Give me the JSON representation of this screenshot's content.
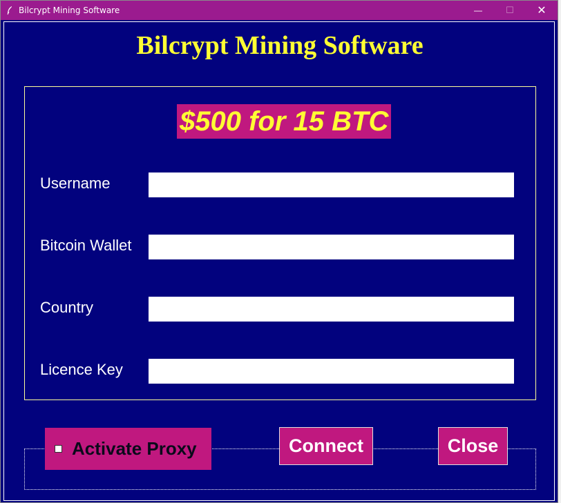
{
  "window": {
    "title": "Bilcrypt Mining Software",
    "controls": {
      "minimize": "—",
      "maximize": "☐",
      "close": "✕"
    }
  },
  "header": {
    "title": "Bilcrypt Mining Software"
  },
  "offer": {
    "text": "$500 for 15 BTC"
  },
  "form": {
    "fields": [
      {
        "label": "Username",
        "value": ""
      },
      {
        "label": "Bitcoin Wallet",
        "value": ""
      },
      {
        "label": "Country",
        "value": ""
      },
      {
        "label": "Licence Key",
        "value": ""
      }
    ]
  },
  "actions": {
    "proxy_label": "Activate Proxy",
    "proxy_checked": false,
    "connect_label": "Connect",
    "close_label": "Close"
  },
  "colors": {
    "background": "#02027e",
    "titlebar": "#9b1b8f",
    "accent": "#c0187f",
    "headline": "#ffff33"
  },
  "icons": {
    "app": "feather-icon"
  }
}
